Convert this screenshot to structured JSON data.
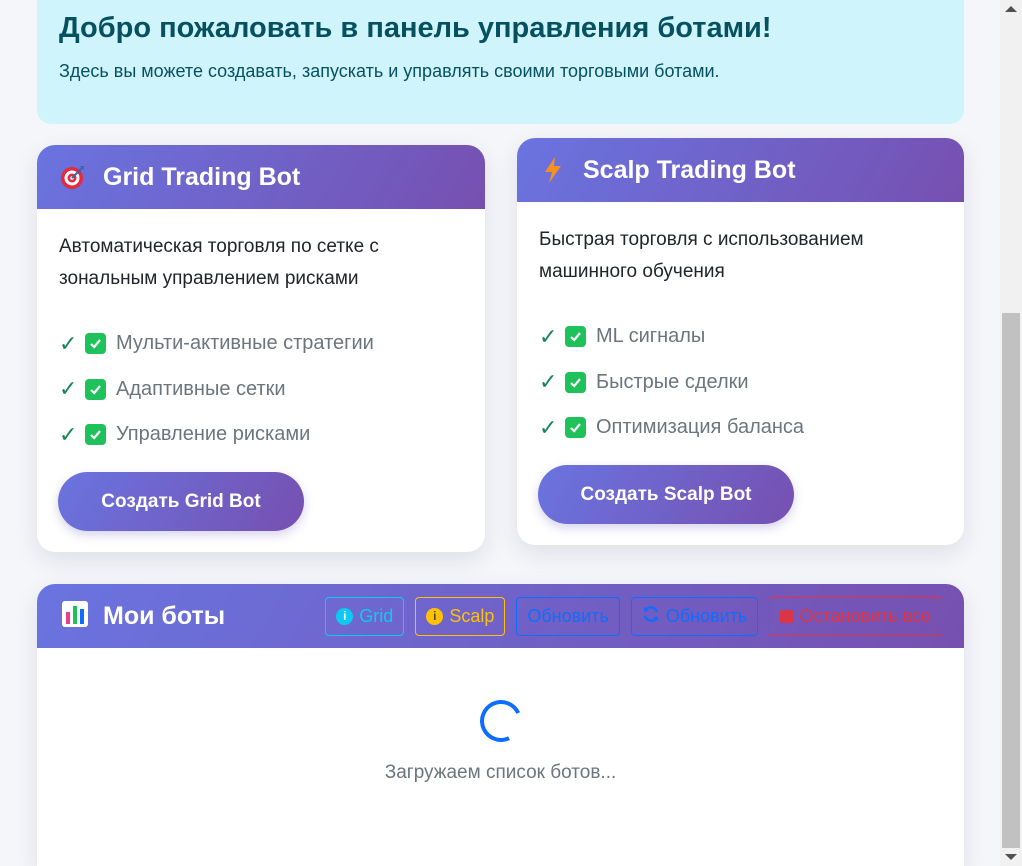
{
  "welcome": {
    "title": "Добро пожаловать в панель управления ботами!",
    "subtitle": "Здесь вы можете создавать, запускать и управлять своими торговыми ботами."
  },
  "grid_card": {
    "icon": "target-icon",
    "title": "Grid Trading Bot",
    "description": "Автоматическая торговля по сетке с зональным управлением рисками",
    "features": [
      "Мульти-активные стратегии",
      "Адаптивные сетки",
      "Управление рисками"
    ],
    "button": "Создать Grid Bot"
  },
  "scalp_card": {
    "icon": "lightning-icon",
    "title": "Scalp Trading Bot",
    "description": "Быстрая торговля с использованием машинного обучения",
    "features": [
      "ML сигналы",
      "Быстрые сделки",
      "Оптимизация баланса"
    ],
    "button": "Создать Scalp Bot"
  },
  "my_bots": {
    "icon": "bar-chart-icon",
    "title": "Мои боты",
    "buttons": {
      "grid": "Grid",
      "scalp": "Scalp",
      "refresh1": "Обновить",
      "refresh2": "Обновить",
      "stop_all": "Остановить все"
    },
    "loading_text": "Загружаем список ботов..."
  },
  "colors": {
    "accent_gradient_start": "#6a74e0",
    "accent_gradient_end": "#7650b0",
    "welcome_bg": "#cff4fc",
    "check_green": "#1fc15b",
    "info": "#0dcaf0",
    "warning": "#ffc107",
    "primary": "#0d6efd",
    "danger": "#dc3545"
  }
}
